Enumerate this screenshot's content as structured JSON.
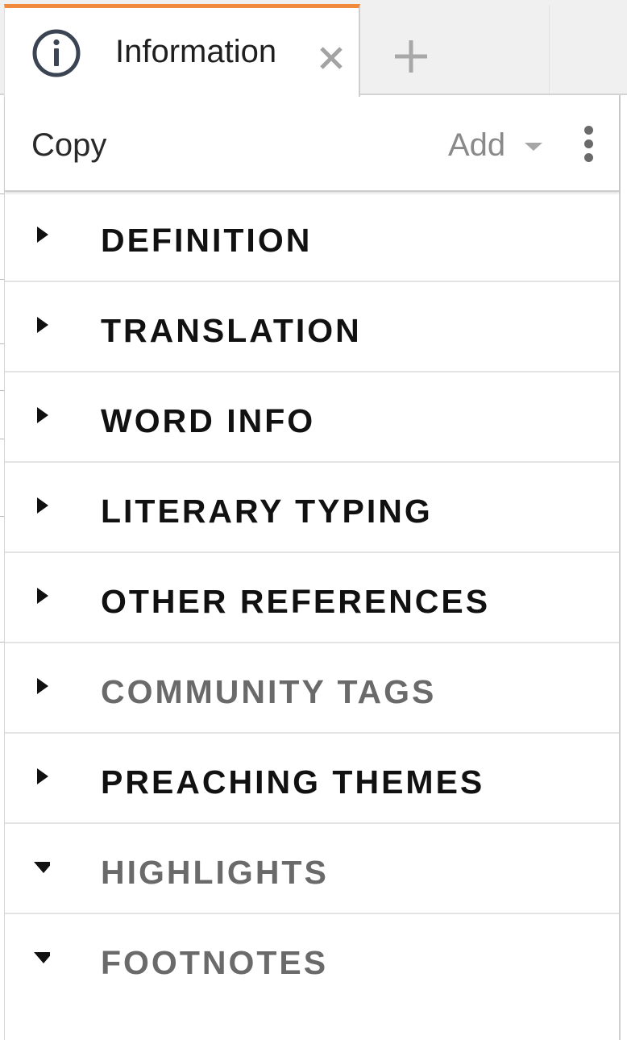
{
  "tabs": {
    "active": {
      "title": "Information",
      "icon": "info-circle-icon"
    },
    "close_icon": "close-icon",
    "add_icon": "plus-icon"
  },
  "toolbar": {
    "copy_label": "Copy",
    "add_label": "Add",
    "more_icon": "vertical-ellipsis-icon"
  },
  "sections": [
    {
      "label": "DEFINITION",
      "expanded": false,
      "dimmed": false
    },
    {
      "label": "TRANSLATION",
      "expanded": false,
      "dimmed": false
    },
    {
      "label": "WORD INFO",
      "expanded": false,
      "dimmed": false
    },
    {
      "label": "LITERARY TYPING",
      "expanded": false,
      "dimmed": false
    },
    {
      "label": "OTHER REFERENCES",
      "expanded": false,
      "dimmed": false
    },
    {
      "label": "COMMUNITY TAGS",
      "expanded": false,
      "dimmed": true
    },
    {
      "label": "PREACHING THEMES",
      "expanded": false,
      "dimmed": false
    },
    {
      "label": "HIGHLIGHTS",
      "expanded": true,
      "dimmed": true
    },
    {
      "label": "FOOTNOTES",
      "expanded": true,
      "dimmed": true
    }
  ],
  "colors": {
    "tab_accent": "#ef8a3f",
    "text_primary": "#111111",
    "text_dimmed": "#6a6a6a",
    "add_label": "#8a8a8a"
  }
}
